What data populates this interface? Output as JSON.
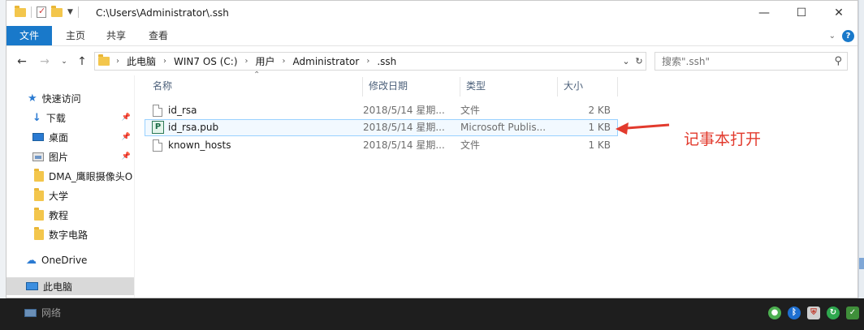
{
  "window": {
    "title": "C:\\Users\\Administrator\\.ssh",
    "minimize_label": "—",
    "maximize_label": "☐",
    "close_label": "✕"
  },
  "ribbon": {
    "tabs": [
      "文件",
      "主页",
      "共享",
      "查看"
    ]
  },
  "address": {
    "crumbs": [
      "此电脑",
      "WIN7 OS (C:)",
      "用户",
      "Administrator",
      ".ssh"
    ]
  },
  "search": {
    "placeholder": "搜索\".ssh\""
  },
  "nav_pane": {
    "items": [
      {
        "label": "快速访问",
        "icon": "star-icon"
      },
      {
        "label": "下载",
        "icon": "download-icon",
        "pinned": true
      },
      {
        "label": "桌面",
        "icon": "desktop-icon",
        "pinned": true
      },
      {
        "label": "图片",
        "icon": "pictures-icon",
        "pinned": true
      },
      {
        "label": "DMA_鹰眼摄像头O",
        "icon": "folder-icon"
      },
      {
        "label": "大学",
        "icon": "folder-icon"
      },
      {
        "label": "教程",
        "icon": "folder-icon"
      },
      {
        "label": "数字电路",
        "icon": "folder-icon"
      },
      {
        "label": "OneDrive",
        "icon": "onedrive-icon"
      },
      {
        "label": "此电脑",
        "icon": "this-pc-icon",
        "selected": true
      },
      {
        "label": "网络",
        "icon": "network-icon"
      }
    ]
  },
  "file_list": {
    "columns": [
      "名称",
      "修改日期",
      "类型",
      "大小"
    ],
    "rows": [
      {
        "name": "id_rsa",
        "date": "2018/5/14 星期...",
        "type": "文件",
        "size": "2 KB",
        "icon": "file-icon"
      },
      {
        "name": "id_rsa.pub",
        "date": "2018/5/14 星期...",
        "type": "Microsoft Publis...",
        "size": "1 KB",
        "icon": "publisher-file-icon",
        "selected": true
      },
      {
        "name": "known_hosts",
        "date": "2018/5/14 星期...",
        "type": "文件",
        "size": "1 KB",
        "icon": "file-icon"
      }
    ]
  },
  "annotation": {
    "text": "记事本打开",
    "color": "#e23a2d"
  },
  "colors": {
    "accent": "#1979ca",
    "selection_border": "#99d1ff",
    "header_text": "#4c607a"
  }
}
